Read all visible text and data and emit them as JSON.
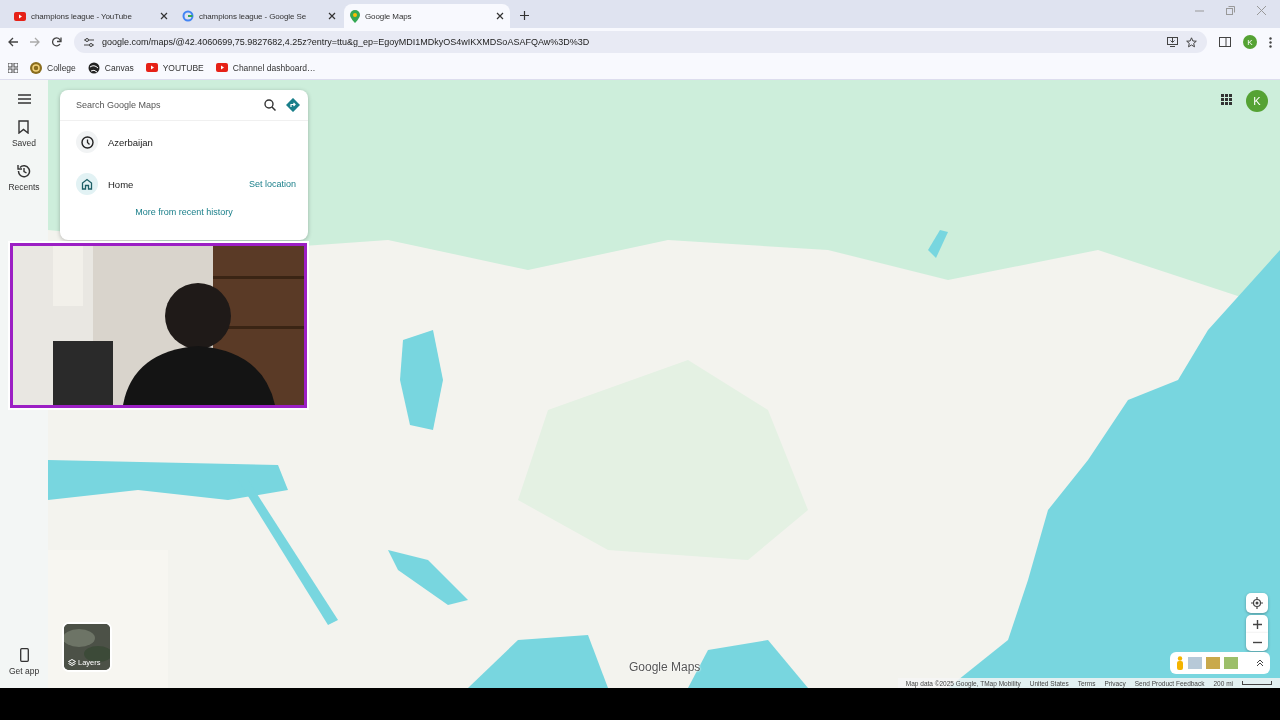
{
  "browser": {
    "tabs": [
      {
        "title": "champions league - YouTube",
        "selected": false,
        "kind": "youtube"
      },
      {
        "title": "champions league - Google Se",
        "selected": false,
        "kind": "google"
      },
      {
        "title": "Google Maps",
        "selected": true,
        "kind": "maps"
      }
    ],
    "url": "google.com/maps/@42.4060699,75.9827682,4.25z?entry=ttu&g_ep=EgoyMDI1MDkyOS4wIKXMDSoASAFQAw%3D%3D",
    "bookmarks": [
      {
        "label": "College",
        "kind": "college"
      },
      {
        "label": "Canvas",
        "kind": "canvas"
      },
      {
        "label": "YOUTUBE",
        "kind": "youtube"
      },
      {
        "label": "Channel dashboard…",
        "kind": "youtube"
      }
    ],
    "profile_initial": "K"
  },
  "maps": {
    "rail": [
      {
        "label": "Saved",
        "kind": "saved"
      },
      {
        "label": "Recents",
        "kind": "recents"
      }
    ],
    "get_app": "Get app",
    "search": {
      "placeholder": "Search Google Maps"
    },
    "recent": [
      {
        "label": "Azerbaijan",
        "kind": "history"
      },
      {
        "label": "Home",
        "kind": "home",
        "action": "Set location"
      }
    ],
    "more_link": "More from recent history",
    "layers": "Layers",
    "account_initial": "K",
    "logo": "Google Maps",
    "footer": [
      "Map data ©2025 Google, TMap Mobility",
      "United States",
      "Terms",
      "Privacy",
      "Send Product Feedback"
    ],
    "scale": "200 mi"
  }
}
